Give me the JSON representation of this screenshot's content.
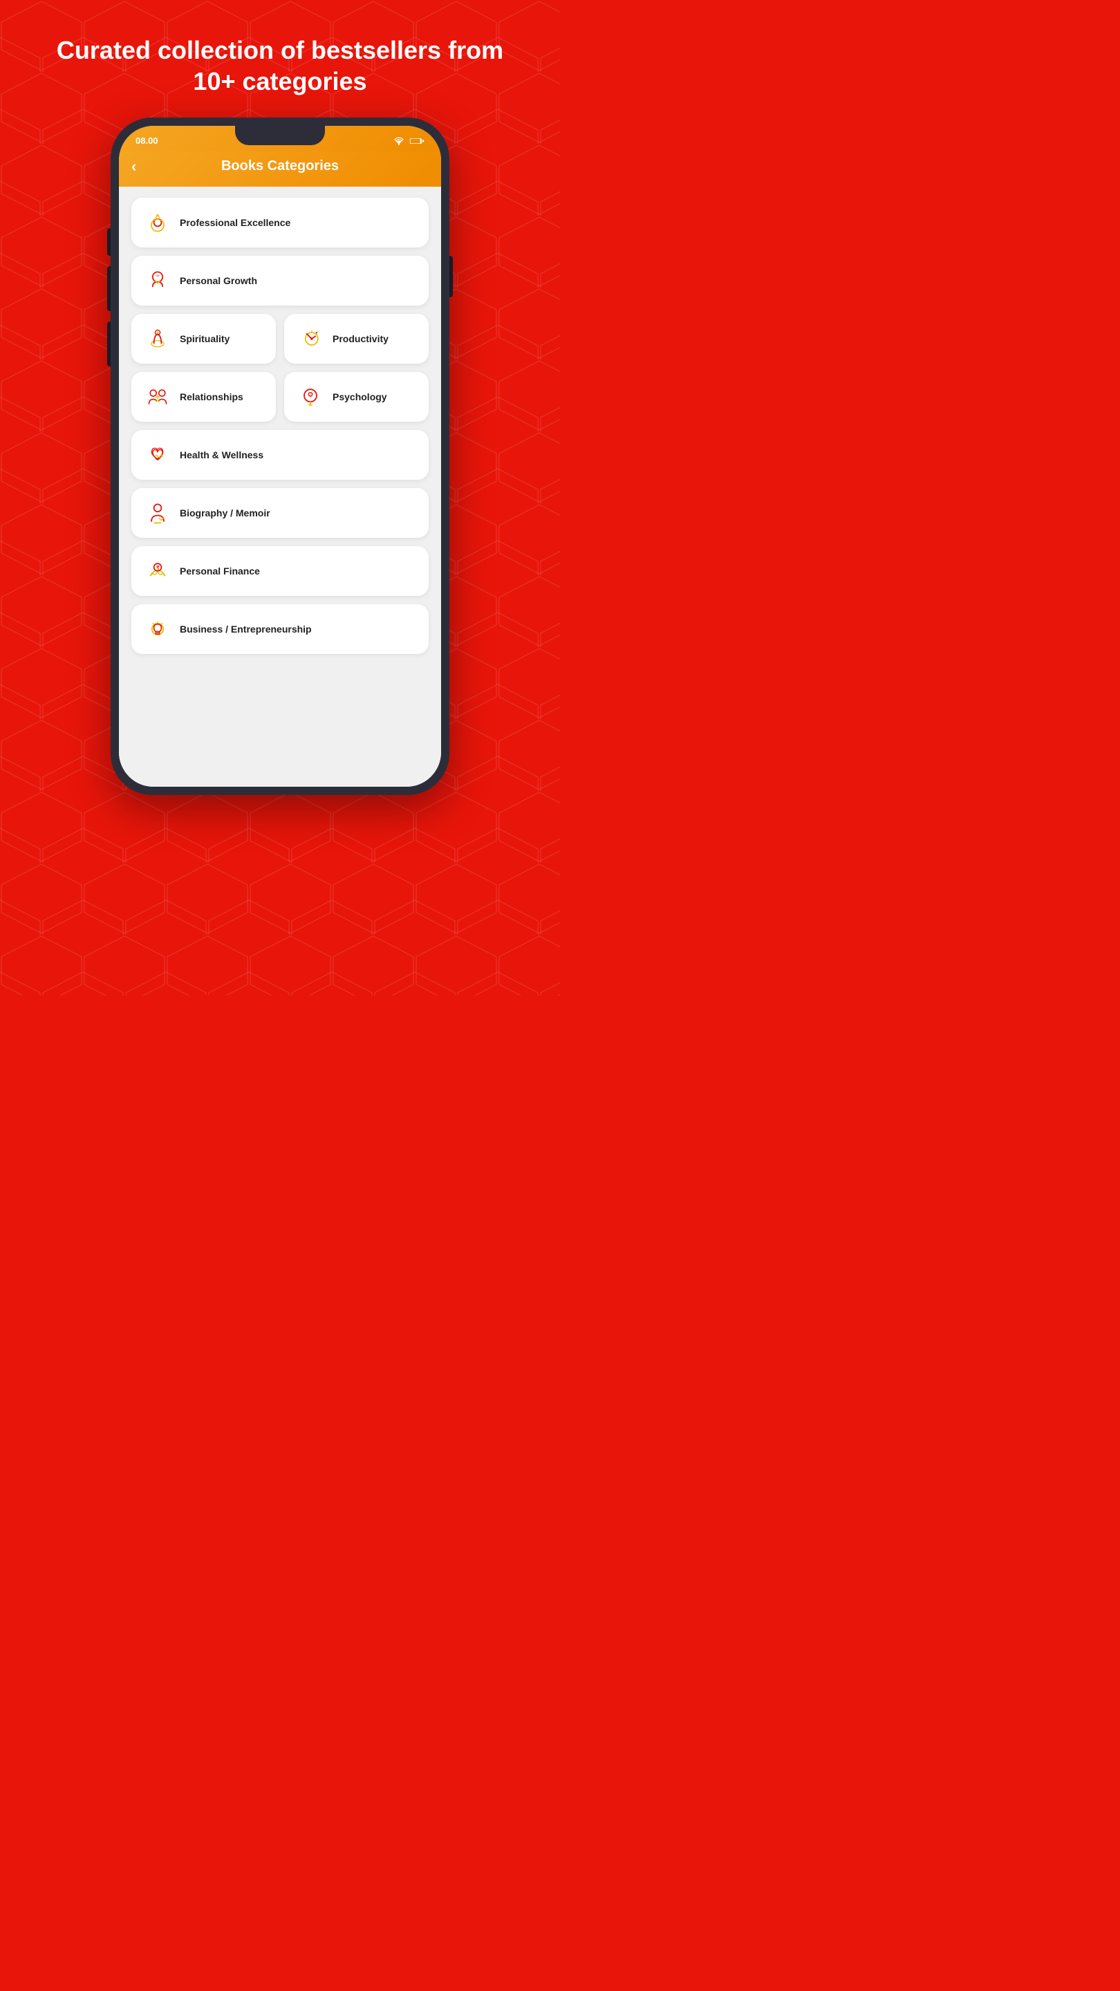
{
  "background": {
    "color": "#e8150a"
  },
  "headline": "Curated collection of bestsellers from 10+ categories",
  "phone": {
    "status_time": "08.00",
    "header_title": "Books Categories",
    "back_label": "‹",
    "categories": [
      {
        "id": "professional-excellence",
        "label": "Professional Excellence",
        "icon": "professional",
        "full_width": true
      },
      {
        "id": "personal-growth",
        "label": "Personal Growth",
        "icon": "personal-growth",
        "full_width": true
      },
      {
        "id": "spirituality",
        "label": "Spirituality",
        "icon": "spirituality",
        "full_width": false
      },
      {
        "id": "productivity",
        "label": "Productivity",
        "icon": "productivity",
        "full_width": false
      },
      {
        "id": "relationships",
        "label": "Relationships",
        "icon": "relationships",
        "full_width": false
      },
      {
        "id": "psychology",
        "label": "Psychology",
        "icon": "psychology",
        "full_width": false
      },
      {
        "id": "health-wellness",
        "label": "Health & Wellness",
        "icon": "health",
        "full_width": true
      },
      {
        "id": "biography-memoir",
        "label": "Biography / Memoir",
        "icon": "biography",
        "full_width": true
      },
      {
        "id": "personal-finance",
        "label": "Personal Finance",
        "icon": "finance",
        "full_width": true
      },
      {
        "id": "business-entrepreneurship",
        "label": "Business / Entrepreneurship",
        "icon": "business",
        "full_width": true
      }
    ]
  }
}
